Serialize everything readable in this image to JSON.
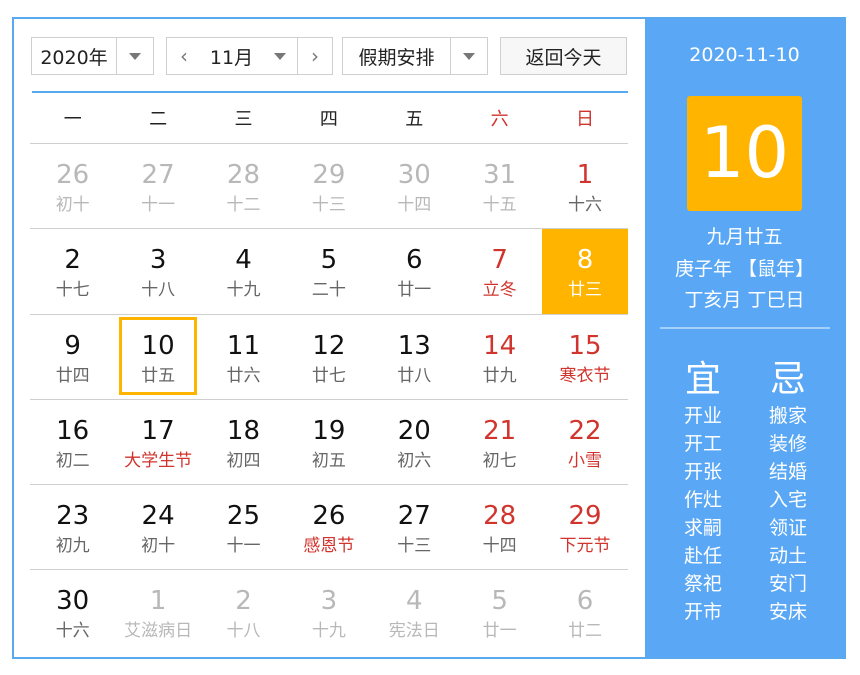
{
  "toolbar": {
    "year_value": "2020年",
    "prev_icon": "‹",
    "month_value": "11月",
    "next_icon": "›",
    "holiday_value": "假期安排",
    "today_button": "返回今天"
  },
  "weekdays": [
    {
      "label": "一",
      "weekend": false
    },
    {
      "label": "二",
      "weekend": false
    },
    {
      "label": "三",
      "weekend": false
    },
    {
      "label": "四",
      "weekend": false
    },
    {
      "label": "五",
      "weekend": false
    },
    {
      "label": "六",
      "weekend": true
    },
    {
      "label": "日",
      "weekend": true
    }
  ],
  "weeks": [
    [
      {
        "day": "26",
        "lunar": "初十",
        "other": true
      },
      {
        "day": "27",
        "lunar": "十一",
        "other": true
      },
      {
        "day": "28",
        "lunar": "十二",
        "other": true
      },
      {
        "day": "29",
        "lunar": "十三",
        "other": true
      },
      {
        "day": "30",
        "lunar": "十四",
        "other": true
      },
      {
        "day": "31",
        "lunar": "十五",
        "other": true
      },
      {
        "day": "1",
        "lunar": "十六",
        "weekend": true
      }
    ],
    [
      {
        "day": "2",
        "lunar": "十七"
      },
      {
        "day": "3",
        "lunar": "十八"
      },
      {
        "day": "4",
        "lunar": "十九"
      },
      {
        "day": "5",
        "lunar": "二十"
      },
      {
        "day": "6",
        "lunar": "廿一"
      },
      {
        "day": "7",
        "lunar": "立冬",
        "weekend": true,
        "festival": true
      },
      {
        "day": "8",
        "lunar": "廿三",
        "weekend": true,
        "selected": true
      }
    ],
    [
      {
        "day": "9",
        "lunar": "廿四"
      },
      {
        "day": "10",
        "lunar": "廿五",
        "today": true
      },
      {
        "day": "11",
        "lunar": "廿六"
      },
      {
        "day": "12",
        "lunar": "廿七"
      },
      {
        "day": "13",
        "lunar": "廿八"
      },
      {
        "day": "14",
        "lunar": "廿九",
        "weekend": true
      },
      {
        "day": "15",
        "lunar": "寒衣节",
        "weekend": true,
        "festival": true
      }
    ],
    [
      {
        "day": "16",
        "lunar": "初二"
      },
      {
        "day": "17",
        "lunar": "大学生节",
        "festival": true
      },
      {
        "day": "18",
        "lunar": "初四"
      },
      {
        "day": "19",
        "lunar": "初五"
      },
      {
        "day": "20",
        "lunar": "初六"
      },
      {
        "day": "21",
        "lunar": "初七",
        "weekend": true
      },
      {
        "day": "22",
        "lunar": "小雪",
        "weekend": true,
        "festival": true
      }
    ],
    [
      {
        "day": "23",
        "lunar": "初九"
      },
      {
        "day": "24",
        "lunar": "初十"
      },
      {
        "day": "25",
        "lunar": "十一"
      },
      {
        "day": "26",
        "lunar": "感恩节",
        "festival": true
      },
      {
        "day": "27",
        "lunar": "十三"
      },
      {
        "day": "28",
        "lunar": "十四",
        "weekend": true
      },
      {
        "day": "29",
        "lunar": "下元节",
        "weekend": true,
        "festival": true
      }
    ],
    [
      {
        "day": "30",
        "lunar": "十六"
      },
      {
        "day": "1",
        "lunar": "艾滋病日",
        "other": true
      },
      {
        "day": "2",
        "lunar": "十八",
        "other": true
      },
      {
        "day": "3",
        "lunar": "十九",
        "other": true
      },
      {
        "day": "4",
        "lunar": "宪法日",
        "other": true
      },
      {
        "day": "5",
        "lunar": "廿一",
        "other": true
      },
      {
        "day": "6",
        "lunar": "廿二",
        "other": true
      }
    ]
  ],
  "side": {
    "date": "2020-11-10",
    "big_day": "10",
    "lunar_date": "九月廿五",
    "year_ganzhi": "庚子年 【鼠年】",
    "month_day_ganzhi": "丁亥月 丁巳日",
    "yi_title": "宜",
    "ji_title": "忌",
    "yi_items": [
      "开业",
      "开工",
      "开张",
      "作灶",
      "求嗣",
      "赴任",
      "祭祀",
      "开市"
    ],
    "ji_items": [
      "搬家",
      "装修",
      "结婚",
      "入宅",
      "领证",
      "动土",
      "安门",
      "安床"
    ]
  },
  "colors": {
    "accent_blue": "#5aa8f5",
    "highlight_orange": "#ffb400",
    "festival_red": "#d0342c"
  }
}
